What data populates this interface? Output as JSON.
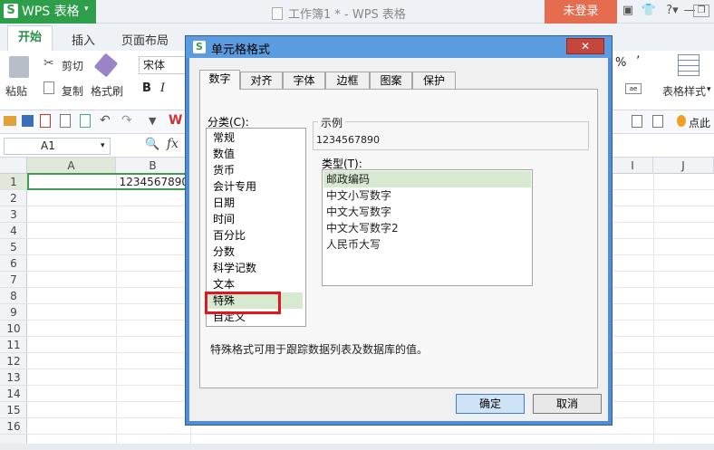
{
  "app": {
    "name": "WPS 表格",
    "logo_letter": "S",
    "dropdown_arrow": "▾"
  },
  "window": {
    "title": "工作簿1 * - WPS 表格",
    "login_label": "未登录",
    "icons": [
      "skin-icon",
      "shirt-icon",
      "help-icon",
      "minimize-icon",
      "restore-icon"
    ]
  },
  "ribbon": {
    "tabs": [
      "开始",
      "插入",
      "页面布局"
    ],
    "paste_label": "粘贴",
    "cut_label": "剪切",
    "copy_label": "复制",
    "format_painter_label": "格式刷",
    "font_name": "宋体",
    "bold": "B",
    "italic": "I",
    "table_style_label": "表格样式",
    "percent": "%",
    "comma": "’",
    "ellipsis_right": "点此"
  },
  "formula": {
    "cell_ref": "A1",
    "fx": "fx"
  },
  "grid": {
    "columns": [
      "A",
      "B",
      "I",
      "J"
    ],
    "rows": [
      "1",
      "2",
      "3",
      "4",
      "5",
      "6",
      "7",
      "8",
      "9",
      "10",
      "11",
      "12",
      "13",
      "14",
      "15",
      "16"
    ],
    "a1_value": "1234567890"
  },
  "dialog": {
    "title": "单元格格式",
    "close": "✕",
    "tabs": [
      "数字",
      "对齐",
      "字体",
      "边框",
      "图案",
      "保护"
    ],
    "active_tab": "数字",
    "category_label": "分类(C):",
    "categories": [
      "常规",
      "数值",
      "货币",
      "会计专用",
      "日期",
      "时间",
      "百分比",
      "分数",
      "科学记数",
      "文本",
      "特殊",
      "自定义"
    ],
    "selected_category": "特殊",
    "sample_label": "示例",
    "sample_value": "1234567890",
    "type_label": "类型(T):",
    "types": [
      "邮政编码",
      "中文小写数字",
      "中文大写数字",
      "中文大写数字2",
      "人民币大写"
    ],
    "selected_type": "邮政编码",
    "description": "特殊格式可用于跟踪数据列表及数据库的值。",
    "ok_label": "确定",
    "cancel_label": "取消"
  },
  "colors": {
    "accent_green": "#2f9e4b",
    "dialog_blue": "#4d8ed6",
    "highlight_red": "#e0171b",
    "login": "#e66c4f"
  }
}
